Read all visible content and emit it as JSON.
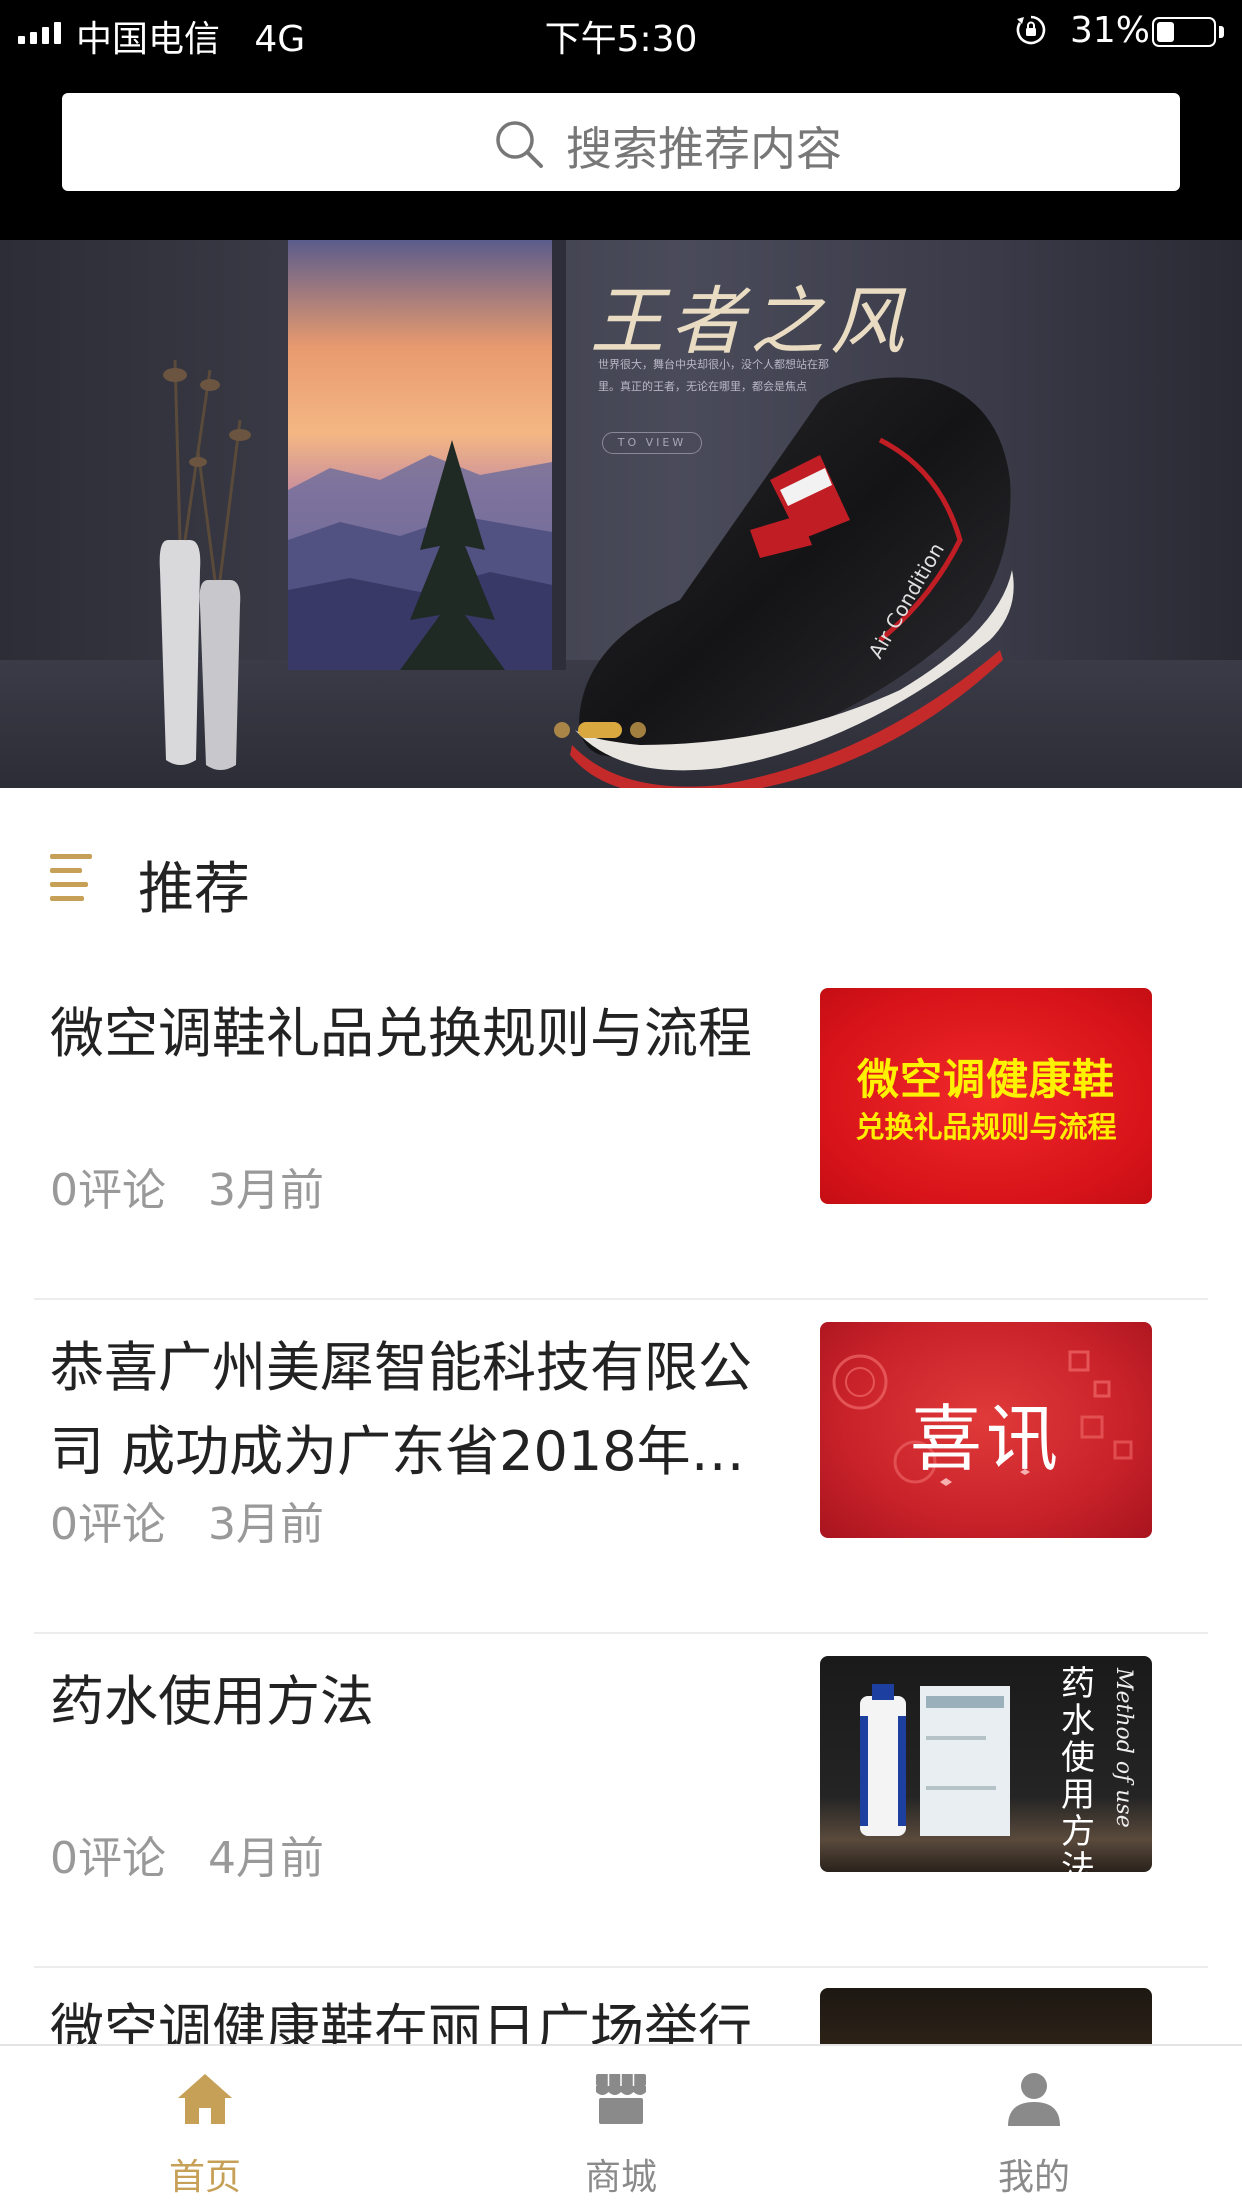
{
  "status_bar": {
    "carrier": "中国电信   4G",
    "time": "下午5:30",
    "battery_percent": "31%",
    "battery_level": 0.31
  },
  "search": {
    "placeholder": "搜索推荐内容",
    "icon": "search-icon"
  },
  "banner": {
    "title": "王者之风",
    "subtitle": "世界很大，舞台中央却很小，没个人都想站在那里。真正的王者，无论在哪里，都会是焦点",
    "cta": "TO VIEW",
    "shoe_text": "Air Condition",
    "slide_count": 3,
    "active_slide": 2
  },
  "section": {
    "icon": "list-icon",
    "title": "推荐"
  },
  "articles": [
    {
      "title": "微空调鞋礼品兑换规则与流程",
      "comments": "0评论",
      "time": "3月前",
      "thumb_line1": "微空调健康鞋",
      "thumb_line2": "兑换礼品规则与流程"
    },
    {
      "title": "恭喜广州美犀智能科技有限公司 成功成为广东省2018年…",
      "comments": "0评论",
      "time": "3月前",
      "thumb_text": "喜讯"
    },
    {
      "title": "药水使用方法",
      "comments": "0评论",
      "time": "4月前",
      "thumb_text": "药水使用方法",
      "thumb_script": "Method of use"
    },
    {
      "title": "微空调健康鞋在丽日广场举行"
    }
  ],
  "tab_bar": {
    "tabs": [
      {
        "label": "首页",
        "icon": "home-icon",
        "active": true
      },
      {
        "label": "商城",
        "icon": "store-icon",
        "active": false
      },
      {
        "label": "我的",
        "icon": "user-icon",
        "active": false
      }
    ]
  },
  "colors": {
    "accent": "#c7a058",
    "inactive": "#8a8a8a",
    "header_bg": "#000000"
  }
}
